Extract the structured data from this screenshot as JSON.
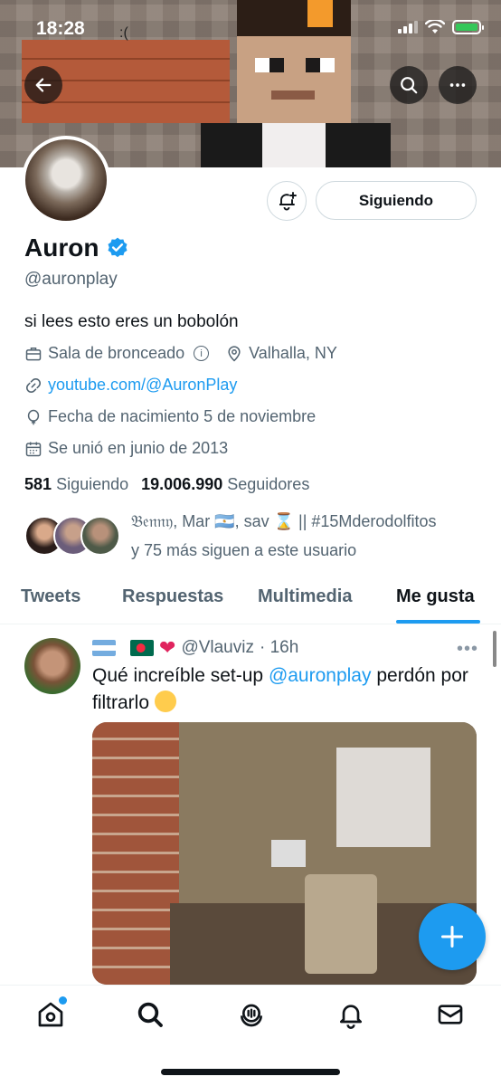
{
  "status_bar": {
    "time": "18:28",
    "face": ":("
  },
  "profile": {
    "name": "Auron",
    "handle": "@auronplay",
    "bio": "si lees esto eres un bobolón",
    "category": "Sala de bronceado",
    "location": "Valhalla, NY",
    "website": "youtube.com/@AuronPlay",
    "birthday": "Fecha de nacimiento 5 de noviembre",
    "joined": "Se unió en junio de 2013",
    "following_count": "581",
    "following_label": "Siguiendo",
    "followers_count": "19.006.990",
    "followers_label": "Seguidores",
    "follow_button": "Siguiendo",
    "followers_you_know_line1": "𝔅𝔢𝔫𝔫𝔶, Mar 🇦🇷, sav ⌛ || #15Mderodolfitos",
    "followers_you_know_line2": "y 75 más siguen a este usuario"
  },
  "tabs": [
    {
      "label": "Tweets",
      "active": false
    },
    {
      "label": "Respuestas",
      "active": false
    },
    {
      "label": "Multimedia",
      "active": false
    },
    {
      "label": "Me gusta",
      "active": true
    }
  ],
  "tweet": {
    "handle": "@Vlauviz",
    "time": "· 16h",
    "text_before": "Qué increíble set-up ",
    "mention": "@auronplay",
    "text_after": " perdón por filtrarlo"
  },
  "icons": {
    "back": "back-arrow-icon",
    "search": "search-icon",
    "more": "more-icon",
    "notif": "bell-plus-icon",
    "verified": "verified-badge-icon",
    "nav": [
      "home-icon",
      "search-icon",
      "spaces-icon",
      "bell-icon",
      "mail-icon"
    ]
  },
  "colors": {
    "accent": "#1d9bf0",
    "text": "#0f1419",
    "secondary": "#536471"
  }
}
